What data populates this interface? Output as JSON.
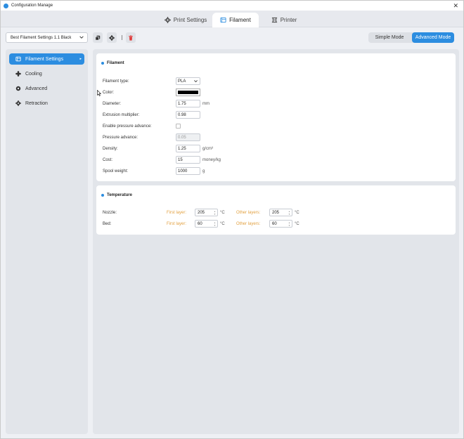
{
  "window": {
    "title": "Configuration Manage",
    "close_glyph": "✕"
  },
  "tabs": [
    {
      "label": "Print Settings",
      "icon": "gear-icon",
      "active": false
    },
    {
      "label": "Filament",
      "icon": "filament-icon",
      "active": true
    },
    {
      "label": "Printer",
      "icon": "printer-icon",
      "active": false
    }
  ],
  "toolbar": {
    "preset": "Best Filament Settings 1.1 Black",
    "separator": "|",
    "modes": {
      "simple": "Simple Mode",
      "advanced": "Advanced Mode",
      "active": "advanced"
    }
  },
  "sidebar": {
    "items": [
      {
        "label": "Filament Settings",
        "icon": "filament-settings-icon",
        "active": true,
        "chevron": "▸"
      },
      {
        "label": "Cooling",
        "icon": "fan-icon",
        "active": false
      },
      {
        "label": "Advanced",
        "icon": "advanced-icon",
        "active": false
      },
      {
        "label": "Retraction",
        "icon": "retraction-icon",
        "active": false
      }
    ]
  },
  "filament": {
    "title": "Filament",
    "type_label": "Filament type:",
    "type_value": "PLA",
    "color_label": "Color:",
    "color_value": "#000000",
    "diameter_label": "Diameter:",
    "diameter_value": "1.75",
    "diameter_unit": "mm",
    "extrusion_label": "Extrusion multiplier:",
    "extrusion_value": "0.98",
    "enable_pa_label": "Enable pressure advance:",
    "enable_pa_checked": false,
    "pa_label": "Pressure advance:",
    "pa_value": "0.05",
    "density_label": "Density:",
    "density_value": "1.25",
    "density_unit": "g/cm³",
    "cost_label": "Cost:",
    "cost_value": "15",
    "cost_unit": "money/kg",
    "spool_label": "Spool weight:",
    "spool_value": "1000",
    "spool_unit": "g"
  },
  "temperature": {
    "title": "Temperature",
    "first_layer_label": "First layer:",
    "other_layers_label": "Other layers:",
    "unit": "°C",
    "nozzle": {
      "label": "Nozzle:",
      "first": "205",
      "other": "205"
    },
    "bed": {
      "label": "Bed:",
      "first": "60",
      "other": "60"
    }
  },
  "colors": {
    "accent": "#2c8de0",
    "delete": "#e03c3c",
    "temp_label": "#e2a03f"
  }
}
